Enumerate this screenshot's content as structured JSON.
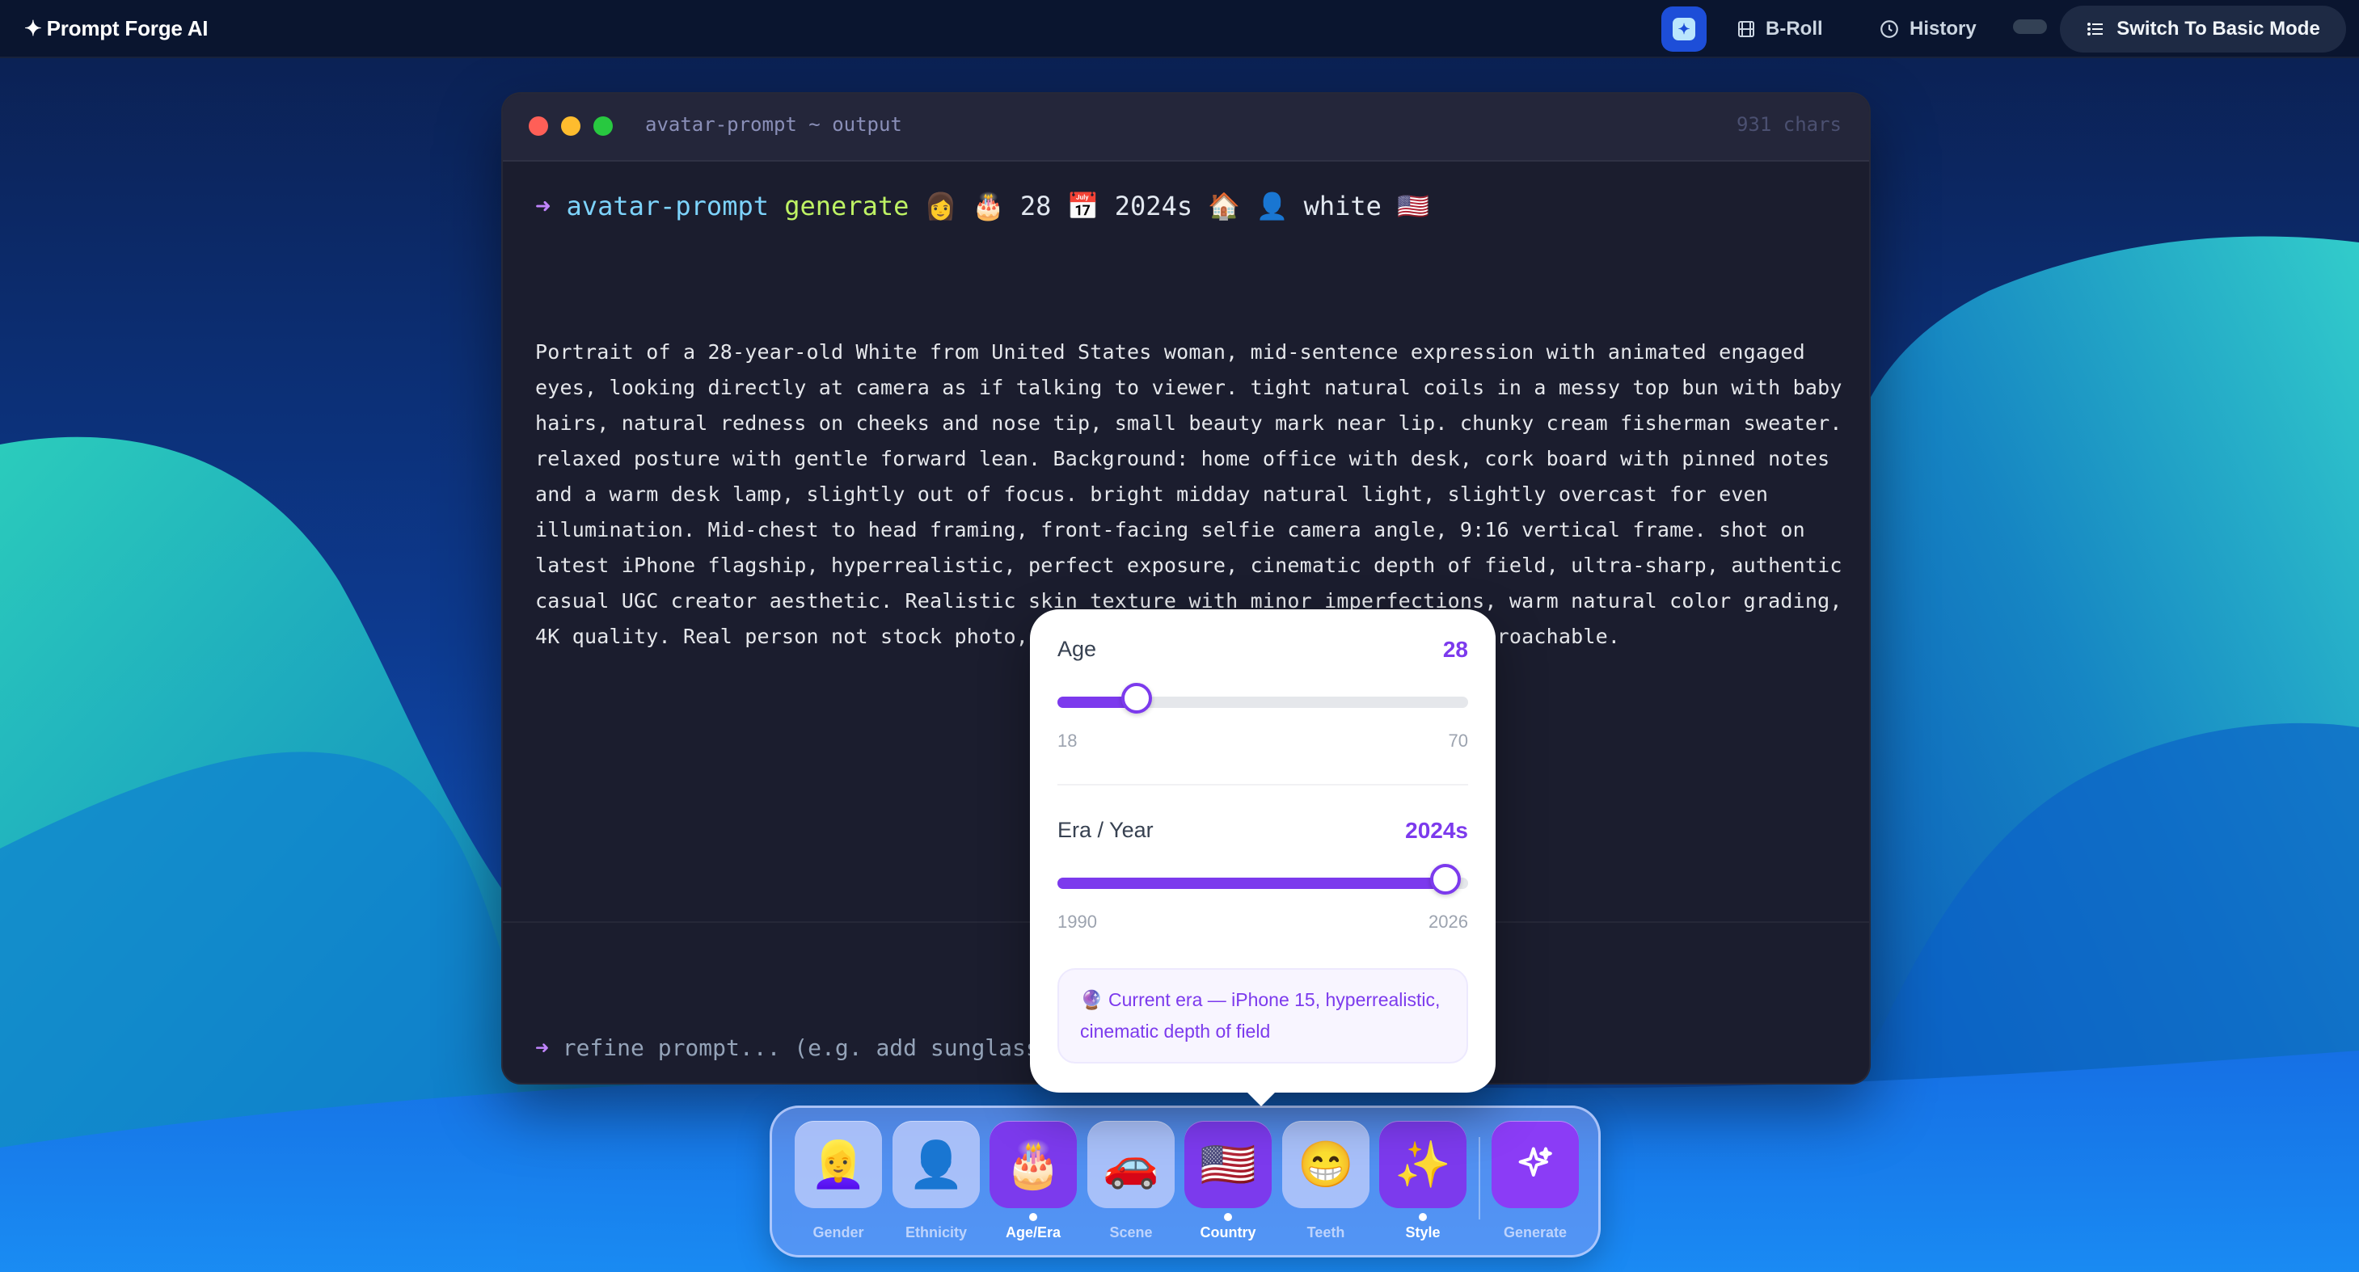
{
  "app": {
    "title": "Prompt Forge AI",
    "logo_glyph": "✦"
  },
  "nav": {
    "broll_label": "B-Roll",
    "history_label": "History",
    "basic_mode_label": "Switch To Basic Mode"
  },
  "terminal": {
    "title": "avatar-prompt ~ output",
    "char_count": "931 chars",
    "cmd": {
      "arrow": "➜",
      "program": "avatar-prompt",
      "verb": "generate",
      "meta": "👩 🎂 28 📅 2024s 🏠 👤 white 🇺🇸"
    },
    "output": "Portrait of a 28-year-old White from United States woman, mid-sentence expression with animated engaged eyes, looking directly at camera as if talking to viewer. tight natural coils in a messy top bun with baby hairs, natural redness on cheeks and nose tip, small beauty mark near lip. chunky cream fisherman sweater. relaxed posture with gentle forward lean. Background: home office with desk, cork board with pinned notes and a warm desk lamp, slightly out of focus. bright midday natural light, slightly overcast for even illumination. Mid-chest to head framing, front-facing selfie camera angle, 9:16 vertical frame. shot on latest iPhone flagship, hyperrealistic, perfect exposure, cinematic depth of field, ultra-sharp, authentic casual UGC creator aesthetic. Realistic skin texture with minor imperfections, warm natural color grading, 4K quality. Real person not stock photo, slight natural grain, unposed and approachable.",
    "refine_arrow": "➜",
    "refine_placeholder": "refine prompt... (e.g. add sunglass"
  },
  "popover": {
    "age": {
      "label": "Age",
      "value_text": "28",
      "value": 28,
      "min": 18,
      "max": 70,
      "min_text": "18",
      "max_text": "70"
    },
    "era": {
      "label": "Era / Year",
      "value_text": "2024s",
      "value": 2024,
      "min": 1990,
      "max": 2026,
      "min_text": "1990",
      "max_text": "2026"
    },
    "note_icon": "🔮",
    "note": "Current era — iPhone 15, hyperrealistic, cinematic depth of field"
  },
  "dock": {
    "items": [
      {
        "key": "gender",
        "label": "Gender",
        "icon": "👱‍♀️",
        "active": false
      },
      {
        "key": "ethnicity",
        "label": "Ethnicity",
        "icon": "👤",
        "active": false
      },
      {
        "key": "age-era",
        "label": "Age/Era",
        "icon": "🎂",
        "active": true
      },
      {
        "key": "scene",
        "label": "Scene",
        "icon": "🚗",
        "active": false
      },
      {
        "key": "country",
        "label": "Country",
        "icon": "🇺🇸",
        "active": true
      },
      {
        "key": "teeth",
        "label": "Teeth",
        "icon": "😁",
        "active": false
      },
      {
        "key": "style",
        "label": "Style",
        "icon": "✨",
        "active": true
      },
      {
        "key": "generate",
        "label": "Generate",
        "icon": "sparkles-icon",
        "active": false
      }
    ]
  },
  "colors": {
    "accent": "#7c3aed",
    "terminal_bg": "#1b1d2e",
    "background_blue": "#0b2f7a"
  }
}
